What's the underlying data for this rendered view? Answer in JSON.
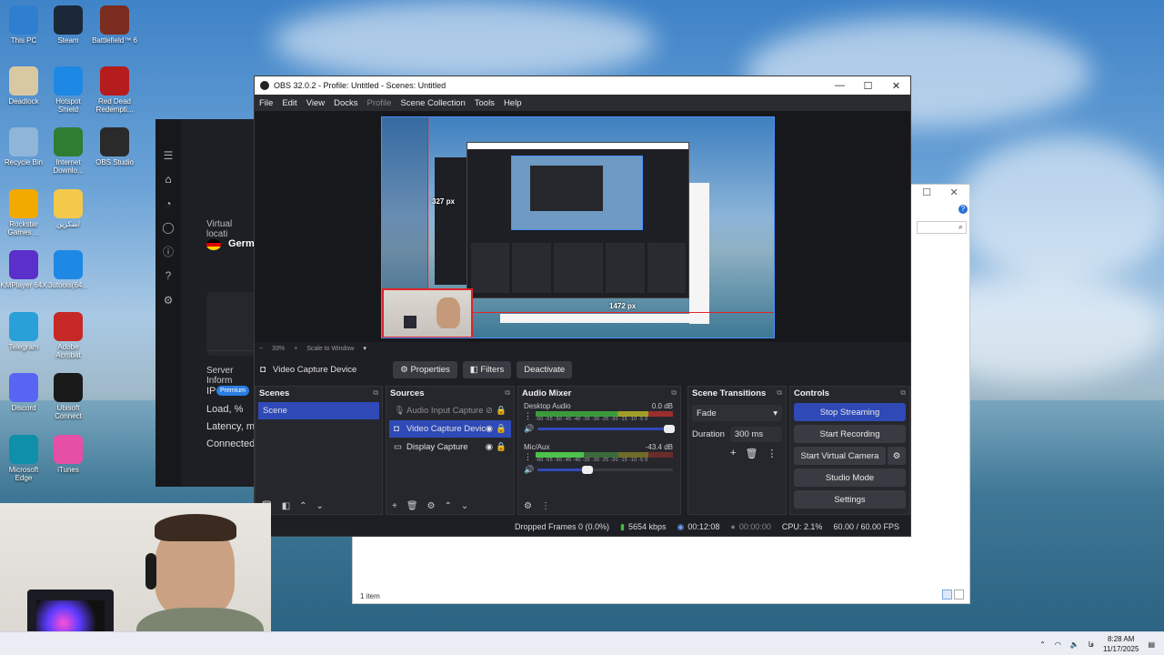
{
  "desktop": {
    "icons": [
      {
        "label": "This PC",
        "icon": "monitor-icon",
        "color": "#2f7fd1"
      },
      {
        "label": "Steam",
        "icon": "steam-icon",
        "color": "#1b2838"
      },
      {
        "label": "Battlefield™ 6",
        "icon": "battlefield-icon",
        "color": "#7a2d1e"
      },
      {
        "label": "Deadlock",
        "icon": "deadlock-icon",
        "color": "#d8c9a3"
      },
      {
        "label": "Hotspot Shield",
        "icon": "hotspot-shield-icon",
        "color": "#1e88e5"
      },
      {
        "label": "Red Dead Redempti...",
        "icon": "rdr-icon",
        "color": "#b71c1c"
      },
      {
        "label": "Recycle Bin",
        "icon": "recycle-bin-icon",
        "color": "#8fb6d8"
      },
      {
        "label": "Internet Downlo...",
        "icon": "idm-icon",
        "color": "#2e7d32"
      },
      {
        "label": "OBS Studio",
        "icon": "obs-icon",
        "color": "#2a2a2a"
      },
      {
        "label": "Rockstar Games ...",
        "icon": "rockstar-icon",
        "color": "#f2a900"
      },
      {
        "label": "اسکرین",
        "icon": "folder-icon",
        "color": "#f3c94b"
      },
      {
        "label": "KMPlayer 64X",
        "icon": "kmplayer-icon",
        "color": "#5b2fc9"
      },
      {
        "label": "3utools(64...",
        "icon": "3utools-icon",
        "color": "#1e88e5"
      },
      {
        "label": "Telegram",
        "icon": "telegram-icon",
        "color": "#29a0d8"
      },
      {
        "label": "Adobe Acrobat",
        "icon": "acrobat-icon",
        "color": "#c62828"
      },
      {
        "label": "Discord",
        "icon": "discord-icon",
        "color": "#5865f2"
      },
      {
        "label": "Ubisoft Connect",
        "icon": "ubisoft-icon",
        "color": "#1a1a1a"
      },
      {
        "label": "Microsoft Edge",
        "icon": "edge-icon",
        "color": "#0f8fa8"
      },
      {
        "label": "iTunes",
        "icon": "itunes-icon",
        "color": "#e54fa6"
      }
    ]
  },
  "vpn": {
    "virtual_location_label": "Virtual locati",
    "country": "Germ",
    "server_info_label": "Server Inform",
    "ip_label": "IP",
    "premium_badge": "Premium",
    "load_label": "Load, %",
    "latency_label": "Latency, m",
    "connected_label": "Connected"
  },
  "obs": {
    "title": "OBS 32.0.2 - Profile: Untitled - Scenes: Untitled",
    "menu": [
      "File",
      "Edit",
      "View",
      "Docks",
      "Profile",
      "Scene Collection",
      "Tools",
      "Help"
    ],
    "preview": {
      "height_label": "327 px",
      "width_label": "1472 px"
    },
    "zoom": {
      "value": "33%",
      "scale_label": "Scale to Window"
    },
    "source_toolbar": {
      "source_name": "Video Capture Device",
      "properties": "Properties",
      "filters": "Filters",
      "deactivate": "Deactivate"
    },
    "scenes": {
      "title": "Scenes",
      "items": [
        "Scene"
      ]
    },
    "sources": {
      "title": "Sources",
      "items": [
        {
          "name": "Audio Input Capture",
          "icon": "microphone-icon"
        },
        {
          "name": "Video Capture Devic",
          "icon": "camera-icon"
        },
        {
          "name": "Display Capture",
          "icon": "display-icon"
        }
      ]
    },
    "audio_mixer": {
      "title": "Audio Mixer",
      "channels": [
        {
          "name": "Desktop Audio",
          "db": "0.0 dB",
          "level": 0.92
        },
        {
          "name": "Mic/Aux",
          "db": "-43.4 dB",
          "level": 0.35
        }
      ],
      "scale": "-60 -55 -50 -45 -40 -35 -30 -25 -20 -15 -10 -5 0"
    },
    "transitions": {
      "title": "Scene Transitions",
      "selected": "Fade",
      "duration_label": "Duration",
      "duration_value": "300 ms"
    },
    "controls": {
      "title": "Controls",
      "stop_streaming": "Stop Streaming",
      "start_recording": "Start Recording",
      "start_virtual_camera": "Start Virtual Camera",
      "studio_mode": "Studio Mode",
      "settings": "Settings"
    },
    "status": {
      "dropped_frames": "Dropped Frames 0 (0.0%)",
      "bitrate": "5654 kbps",
      "stream_time": "00:12:08",
      "record_time": "00:00:00",
      "cpu": "CPU: 2.1%",
      "fps": "60.00 / 60.00 FPS"
    },
    "accent": "#2f4ab7"
  },
  "explorer": {
    "status": "1 item"
  },
  "taskbar": {
    "time": "8:28 AM",
    "date": "11/17/2025",
    "lang": "ﻓﺎ"
  }
}
